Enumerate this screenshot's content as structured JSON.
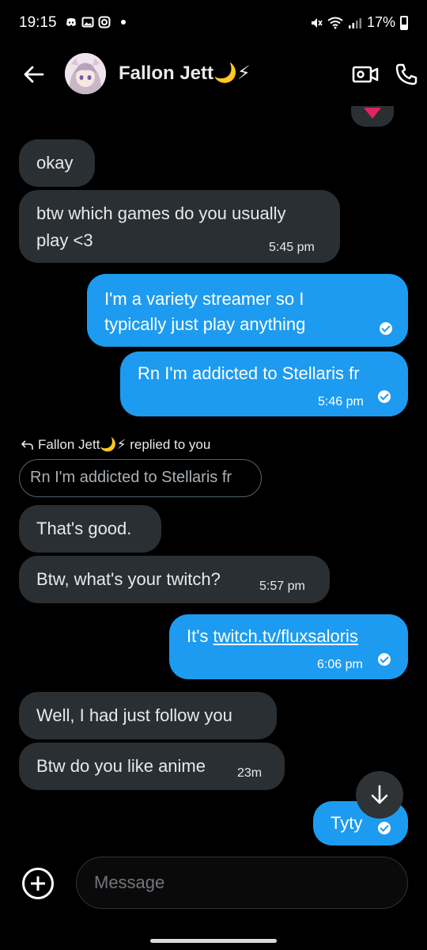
{
  "status_bar": {
    "time": "19:15",
    "battery": "17%",
    "left_icons": [
      "discord-icon",
      "gallery-icon",
      "instagram-icon"
    ],
    "right_icons": [
      "mute-icon",
      "wifi-icon",
      "signal-icon",
      "battery-icon"
    ]
  },
  "header": {
    "contact_name": "Fallon Jett🌙⚡"
  },
  "messages": [
    {
      "id": "m1",
      "direction": "in",
      "text": "okay"
    },
    {
      "id": "m2",
      "direction": "in",
      "lines": [
        "btw which games do you usually",
        "play <3"
      ],
      "time": "5:45 pm"
    },
    {
      "id": "m3",
      "direction": "out",
      "lines": [
        "I'm a variety streamer so I",
        "typically just play anything"
      ],
      "read": true
    },
    {
      "id": "m4",
      "direction": "out",
      "text": "Rn I'm addicted to Stellaris fr",
      "time": "5:46 pm",
      "read": true
    },
    {
      "id": "m5",
      "direction": "in",
      "text": "That's good."
    },
    {
      "id": "m6",
      "direction": "in",
      "text": "Btw, what's your twitch?",
      "time": "5:57 pm"
    },
    {
      "id": "m7",
      "direction": "out",
      "prefix": "It's ",
      "link": "twitch.tv/fluxsaloris",
      "time": "6:06 pm",
      "read": true
    },
    {
      "id": "m8",
      "direction": "in",
      "text": "Well, I had just follow you"
    },
    {
      "id": "m9",
      "direction": "in",
      "text": "Btw do you like anime",
      "time": "23m"
    },
    {
      "id": "m10",
      "direction": "out",
      "text": "Tyty",
      "read": true
    }
  ],
  "reply_context": {
    "label": "Fallon Jett🌙⚡ replied to you",
    "quoted_text": "Rn I'm addicted to Stellaris fr"
  },
  "composer": {
    "placeholder": "Message"
  },
  "colors": {
    "background": "#000000",
    "incoming_bubble": "#2a2f33",
    "outgoing_bubble": "#1d9bf0",
    "reaction_heart": "#e0245e"
  }
}
